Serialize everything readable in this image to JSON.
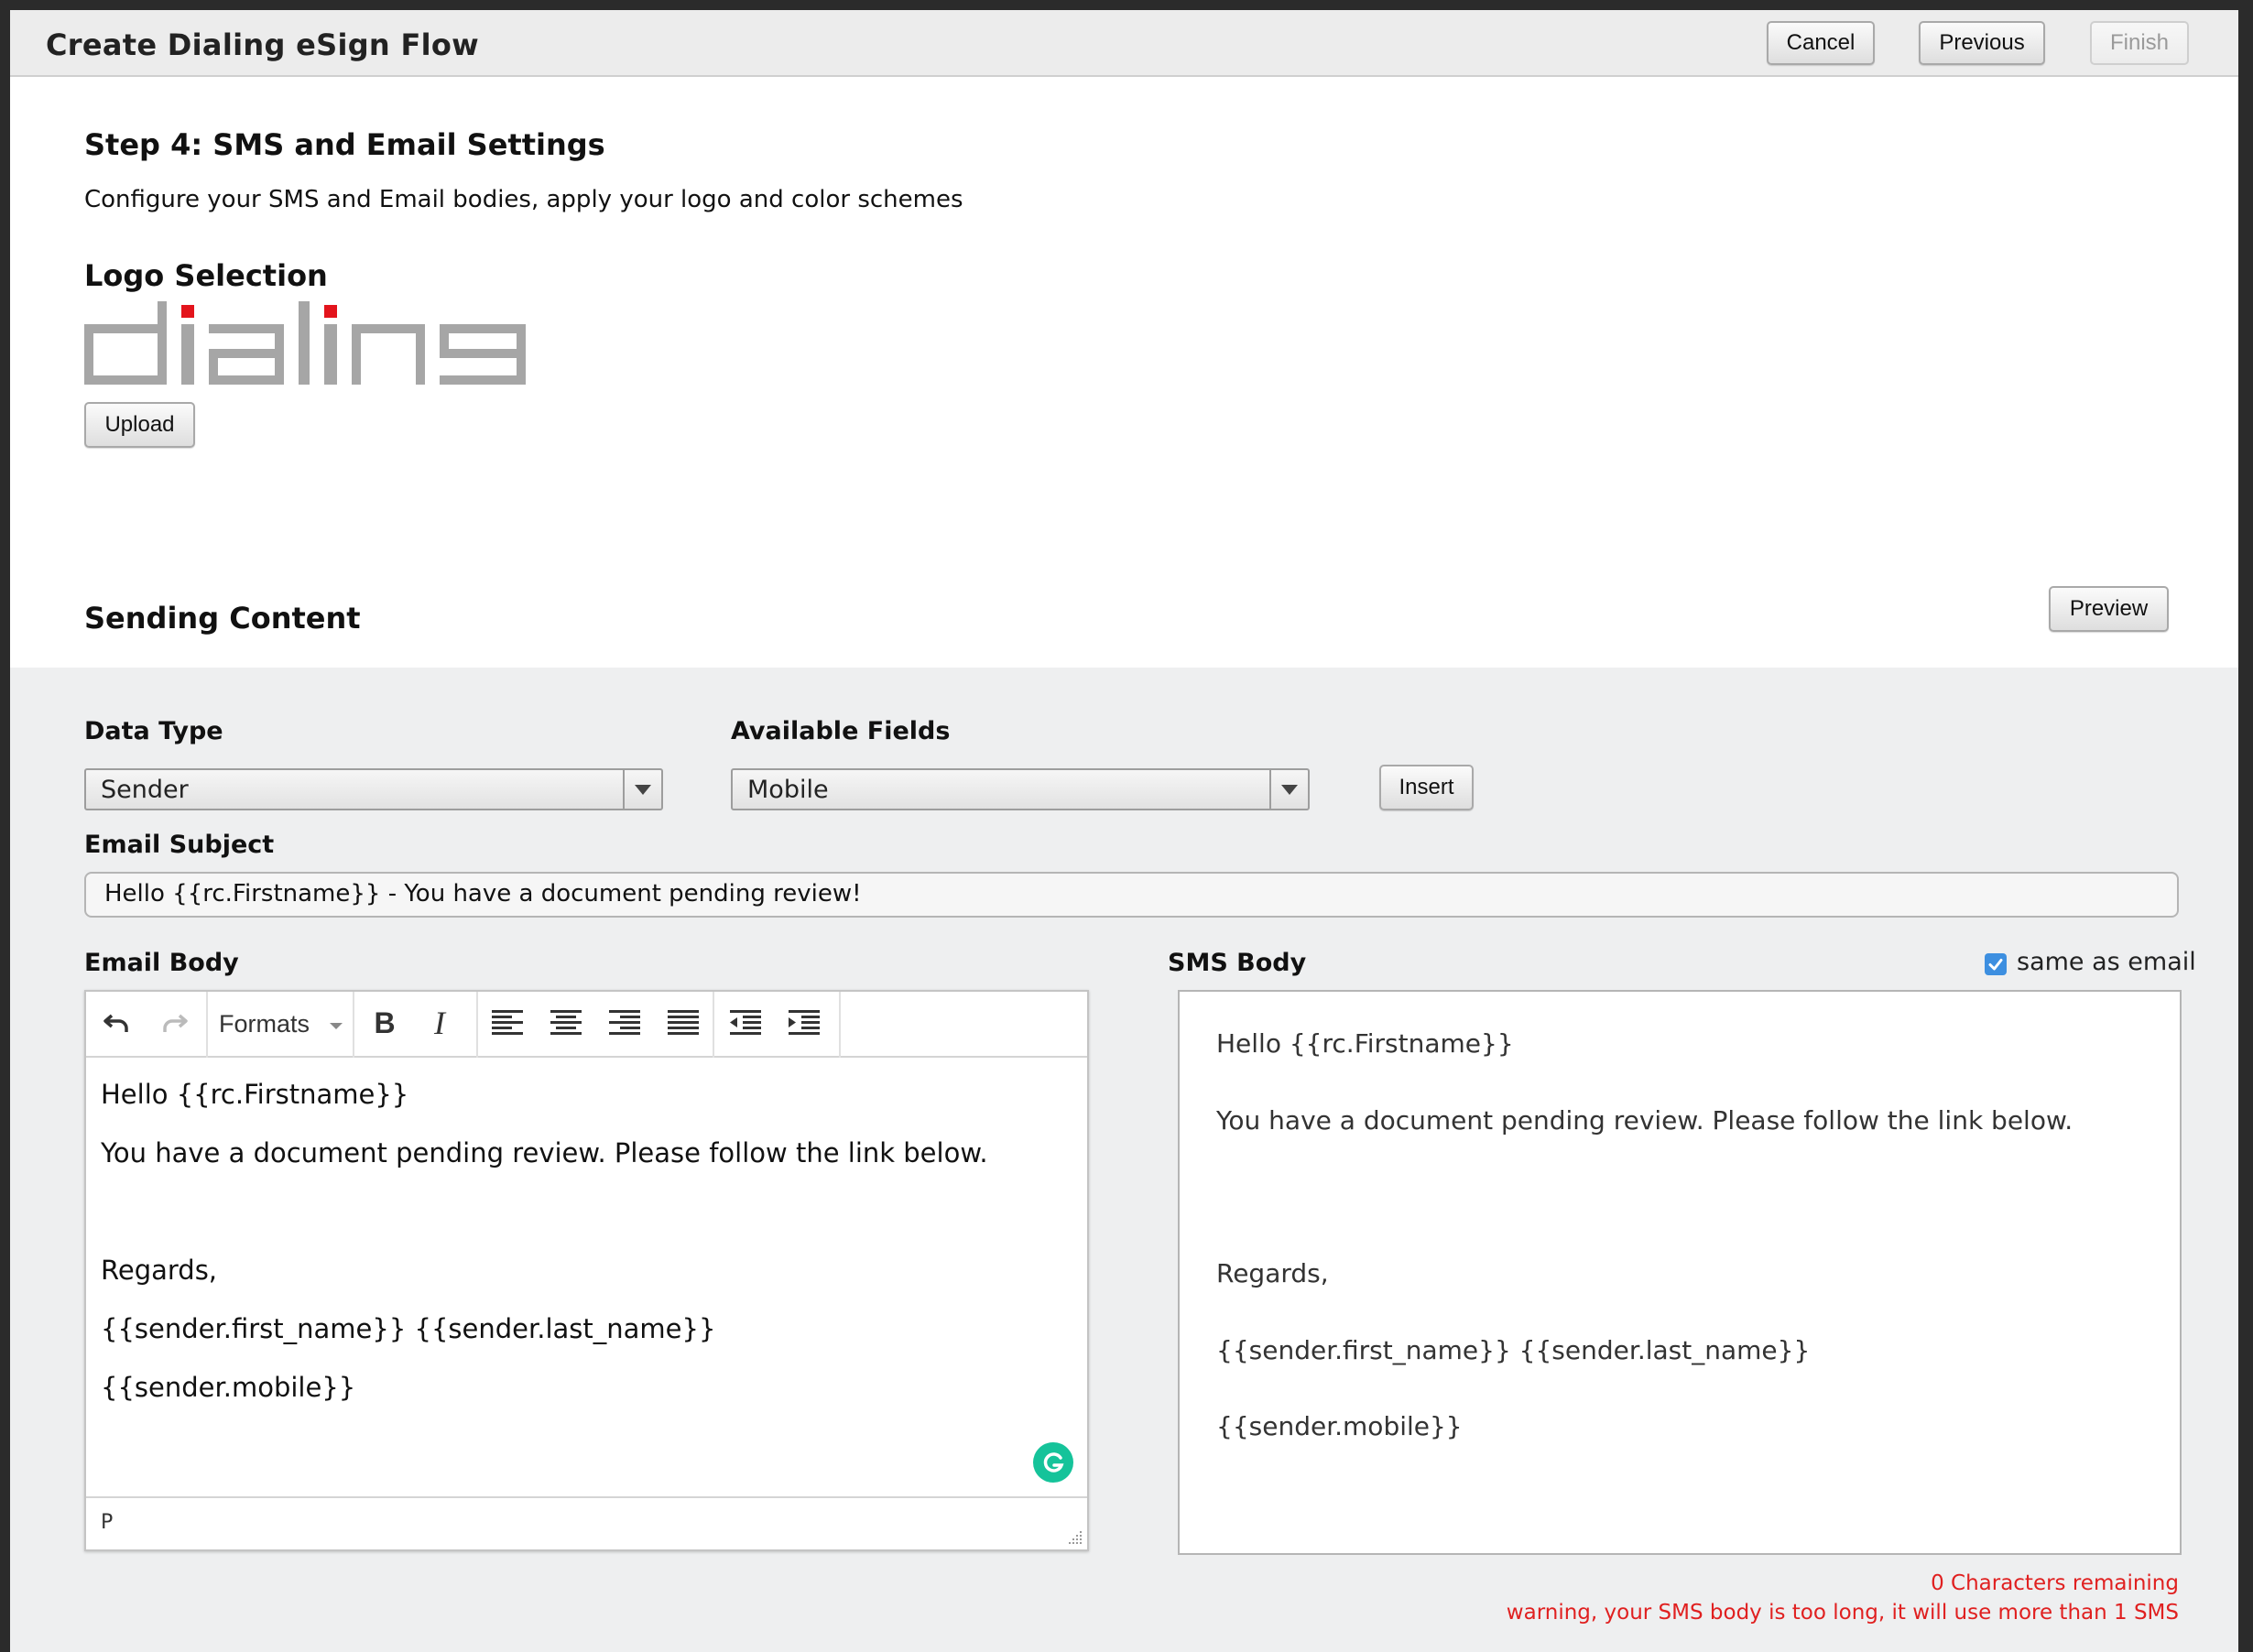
{
  "dialog": {
    "title": "Create Dialing eSign Flow",
    "buttons": {
      "cancel": "Cancel",
      "previous": "Previous",
      "finish": "Finish"
    }
  },
  "step": {
    "heading": "Step 4: SMS and Email Settings",
    "description": "Configure your SMS and Email bodies, apply your logo and color schemes"
  },
  "logo_section": {
    "heading": "Logo Selection",
    "logo_text": "dialing",
    "upload_label": "Upload"
  },
  "sending_content": {
    "heading": "Sending Content",
    "preview_label": "Preview",
    "data_type": {
      "label": "Data Type",
      "value": "Sender"
    },
    "available_fields": {
      "label": "Available Fields",
      "value": "Mobile"
    },
    "insert_label": "Insert",
    "email_subject": {
      "label": "Email Subject",
      "value": "Hello {{rc.Firstname}} - You have a document pending review!"
    },
    "email_body": {
      "label": "Email Body",
      "toolbar": {
        "formats": "Formats"
      },
      "lines": [
        "Hello {{rc.Firstname}}",
        "You have a document pending review. Please follow the link below.",
        "Regards,",
        "{{sender.first_name}} {{sender.last_name}}",
        "{{sender.mobile}}"
      ],
      "path": "P"
    },
    "sms_body": {
      "label": "SMS Body",
      "same_as_email_label": "same as email",
      "same_as_email_checked": true,
      "lines": [
        "Hello {{rc.Firstname}}",
        "You have a document pending review. Please follow the link below.",
        "Regards,",
        "{{sender.first_name}} {{sender.last_name}}",
        "{{sender.mobile}}"
      ]
    },
    "chars_remaining": "0 Characters remaining",
    "warning": "warning, your SMS body is too long, it will use more than 1 SMS"
  },
  "colors": {
    "accent": "#3d8fe0",
    "warning": "#e02020",
    "grammarly": "#15c39a",
    "logo_red": "#e3141c",
    "logo_gray": "#a6a6a6"
  }
}
